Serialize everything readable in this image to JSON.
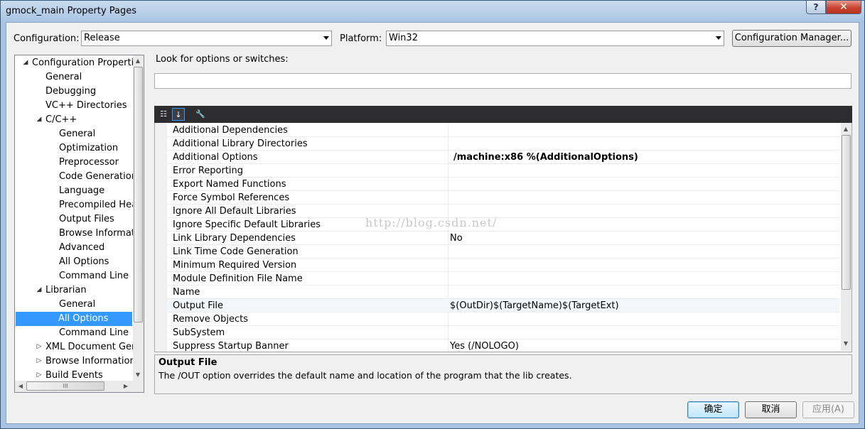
{
  "window": {
    "title": "gmock_main Property Pages",
    "help_label": "?",
    "close_label": "✕"
  },
  "top_bar": {
    "configuration_label": "Configuration:",
    "configuration_value": "Release",
    "platform_label": "Platform:",
    "platform_value": "Win32",
    "config_manager_label": "Configuration Manager..."
  },
  "tree": {
    "items": [
      {
        "label": "Configuration Properties"
      },
      {
        "label": "General"
      },
      {
        "label": "Debugging"
      },
      {
        "label": "VC++ Directories"
      },
      {
        "label": "C/C++"
      },
      {
        "label": "General"
      },
      {
        "label": "Optimization"
      },
      {
        "label": "Preprocessor"
      },
      {
        "label": "Code Generation"
      },
      {
        "label": "Language"
      },
      {
        "label": "Precompiled Headers"
      },
      {
        "label": "Output Files"
      },
      {
        "label": "Browse Information"
      },
      {
        "label": "Advanced"
      },
      {
        "label": "All Options"
      },
      {
        "label": "Command Line"
      },
      {
        "label": "Librarian"
      },
      {
        "label": "General"
      },
      {
        "label": "All Options"
      },
      {
        "label": "Command Line"
      },
      {
        "label": "XML Document Generator"
      },
      {
        "label": "Browse Information"
      },
      {
        "label": "Build Events"
      }
    ],
    "hscroll_grip": "III"
  },
  "search": {
    "label": "Look for options or switches:",
    "value": ""
  },
  "grid": {
    "rows": [
      {
        "name": "Additional Dependencies",
        "value": ""
      },
      {
        "name": "Additional Library Directories",
        "value": ""
      },
      {
        "name": "Additional Options",
        "value": "/machine:x86 %(AdditionalOptions)"
      },
      {
        "name": "Error Reporting",
        "value": ""
      },
      {
        "name": "Export Named Functions",
        "value": ""
      },
      {
        "name": "Force Symbol References",
        "value": ""
      },
      {
        "name": "Ignore All Default Libraries",
        "value": ""
      },
      {
        "name": "Ignore Specific Default Libraries",
        "value": ""
      },
      {
        "name": "Link Library Dependencies",
        "value": "No"
      },
      {
        "name": "Link Time Code Generation",
        "value": ""
      },
      {
        "name": "Minimum Required Version",
        "value": ""
      },
      {
        "name": "Module Definition File Name",
        "value": ""
      },
      {
        "name": "Name",
        "value": ""
      },
      {
        "name": "Output File",
        "value": "$(OutDir)$(TargetName)$(TargetExt)"
      },
      {
        "name": "Remove Objects",
        "value": ""
      },
      {
        "name": "SubSystem",
        "value": ""
      },
      {
        "name": "Suppress Startup Banner",
        "value": "Yes (/NOLOGO)"
      }
    ]
  },
  "description": {
    "title": "Output File",
    "text": "The /OUT option overrides the default name and location of the program that the lib creates."
  },
  "watermark": "http://blog.csdn.net/",
  "buttons": {
    "ok": "确定",
    "cancel": "取消",
    "apply": "应用(A)"
  },
  "colors": {
    "selection": "#3399ff",
    "toolbar_bg": "#2d2d30",
    "frame": "#a9c4e2"
  }
}
